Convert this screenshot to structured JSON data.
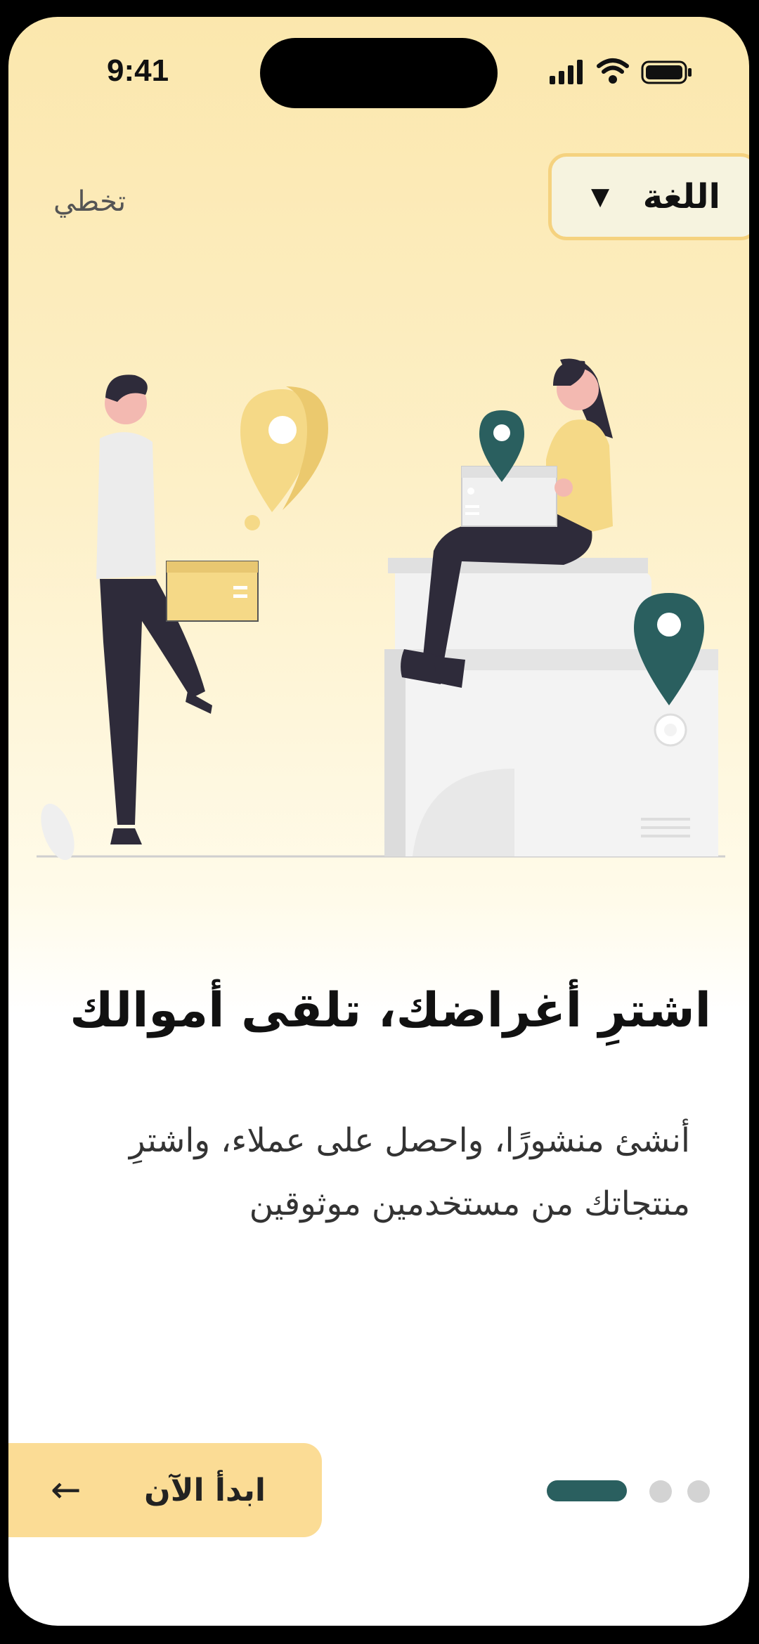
{
  "status_bar": {
    "time": "9:41"
  },
  "header": {
    "skip": "تخطي",
    "language": "اللغة"
  },
  "slide": {
    "title": "اشترِ أغراضك، تلقى أموالك",
    "description": "أنشئ منشورًا، واحصل على عملاء، واشترِ منتجاتك من مستخدمين موثوقين"
  },
  "footer": {
    "start_label": "ابدأ الآن",
    "pages_total": 3,
    "current_page": 1
  },
  "colors": {
    "accent_teal": "#2a5f5f",
    "button_yellow": "#fbdc95",
    "bg_yellow": "#fbe7ad"
  }
}
